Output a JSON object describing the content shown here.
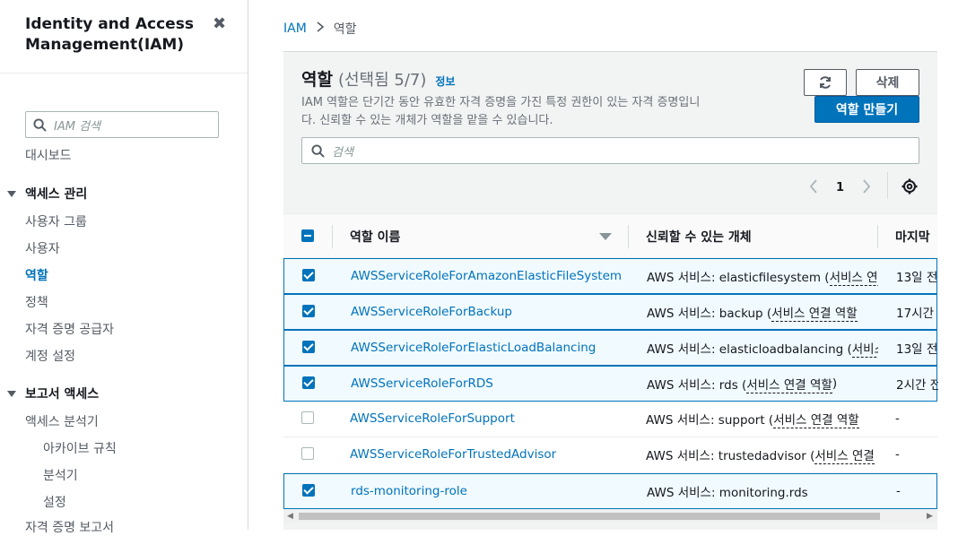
{
  "sidebar": {
    "title": "Identity and Access Management(IAM)",
    "search_placeholder": "IAM 검색",
    "dashboard": "대시보드",
    "section_access": "액세스 관리",
    "access_items": [
      "사용자 그룹",
      "사용자",
      "역할",
      "정책",
      "자격 증명 공급자",
      "계정 설정"
    ],
    "active_item": "역할",
    "section_reports": "보고서 액세스",
    "report_items": [
      "액세스 분석기"
    ],
    "report_sub_items": [
      "아카이브 규칙",
      "분석기",
      "설정"
    ],
    "cutoff_item": "자격 증명 보고서"
  },
  "breadcrumb": {
    "root": "IAM",
    "current": "역할"
  },
  "panel": {
    "title": "역할",
    "count": "(선택됨 5/7)",
    "info": "정보",
    "description": "IAM 역할은 단기간 동안 유효한 자격 증명을 가진 특정 권한이 있는 자격 증명입니다. 신뢰할 수 있는 개체가 역할을 맡을 수 있습니다.",
    "delete_label": "삭제",
    "create_label": "역할 만들기",
    "search_placeholder": "검색",
    "page_number": "1"
  },
  "table": {
    "columns": [
      "역할 이름",
      "신뢰할 수 있는 개체",
      "마지막"
    ],
    "rows": [
      {
        "name": "AWSServiceRoleForAmazonElasticFileSystem",
        "trust_prefix": "AWS 서비스: elasticfilesystem (",
        "trust_link": "서비스 연결",
        "trust_suffix": "",
        "last": "13일 전",
        "checked": true
      },
      {
        "name": "AWSServiceRoleForBackup",
        "trust_prefix": "AWS 서비스: backup (",
        "trust_link": "서비스 연결 역할",
        "trust_suffix": "",
        "last": "17시간",
        "checked": true
      },
      {
        "name": "AWSServiceRoleForElasticLoadBalancing",
        "trust_prefix": "AWS 서비스: elasticloadbalancing (",
        "trust_link": "서비스",
        "trust_suffix": "",
        "last": "13일 전",
        "checked": true
      },
      {
        "name": "AWSServiceRoleForRDS",
        "trust_prefix": "AWS 서비스: rds (",
        "trust_link": "서비스 연결 역할",
        "trust_suffix": ")",
        "last": "2시간 전",
        "checked": true
      },
      {
        "name": "AWSServiceRoleForSupport",
        "trust_prefix": "AWS 서비스: support (",
        "trust_link": "서비스 연결 역할",
        "trust_suffix": "",
        "last": "-",
        "checked": false
      },
      {
        "name": "AWSServiceRoleForTrustedAdvisor",
        "trust_prefix": "AWS 서비스: trustedadvisor (",
        "trust_link": "서비스 연결",
        "trust_suffix": "",
        "last": "-",
        "checked": false
      },
      {
        "name": "rds-monitoring-role",
        "trust_prefix": "AWS 서비스: monitoring.rds",
        "trust_link": "",
        "trust_suffix": "",
        "last": "-",
        "checked": true
      }
    ]
  },
  "icons": {
    "close": "close-icon",
    "search": "search-icon",
    "refresh": "refresh-icon",
    "settings": "gear-icon"
  },
  "colors": {
    "accent": "#0073bb",
    "selected_row": "#f1faff"
  }
}
